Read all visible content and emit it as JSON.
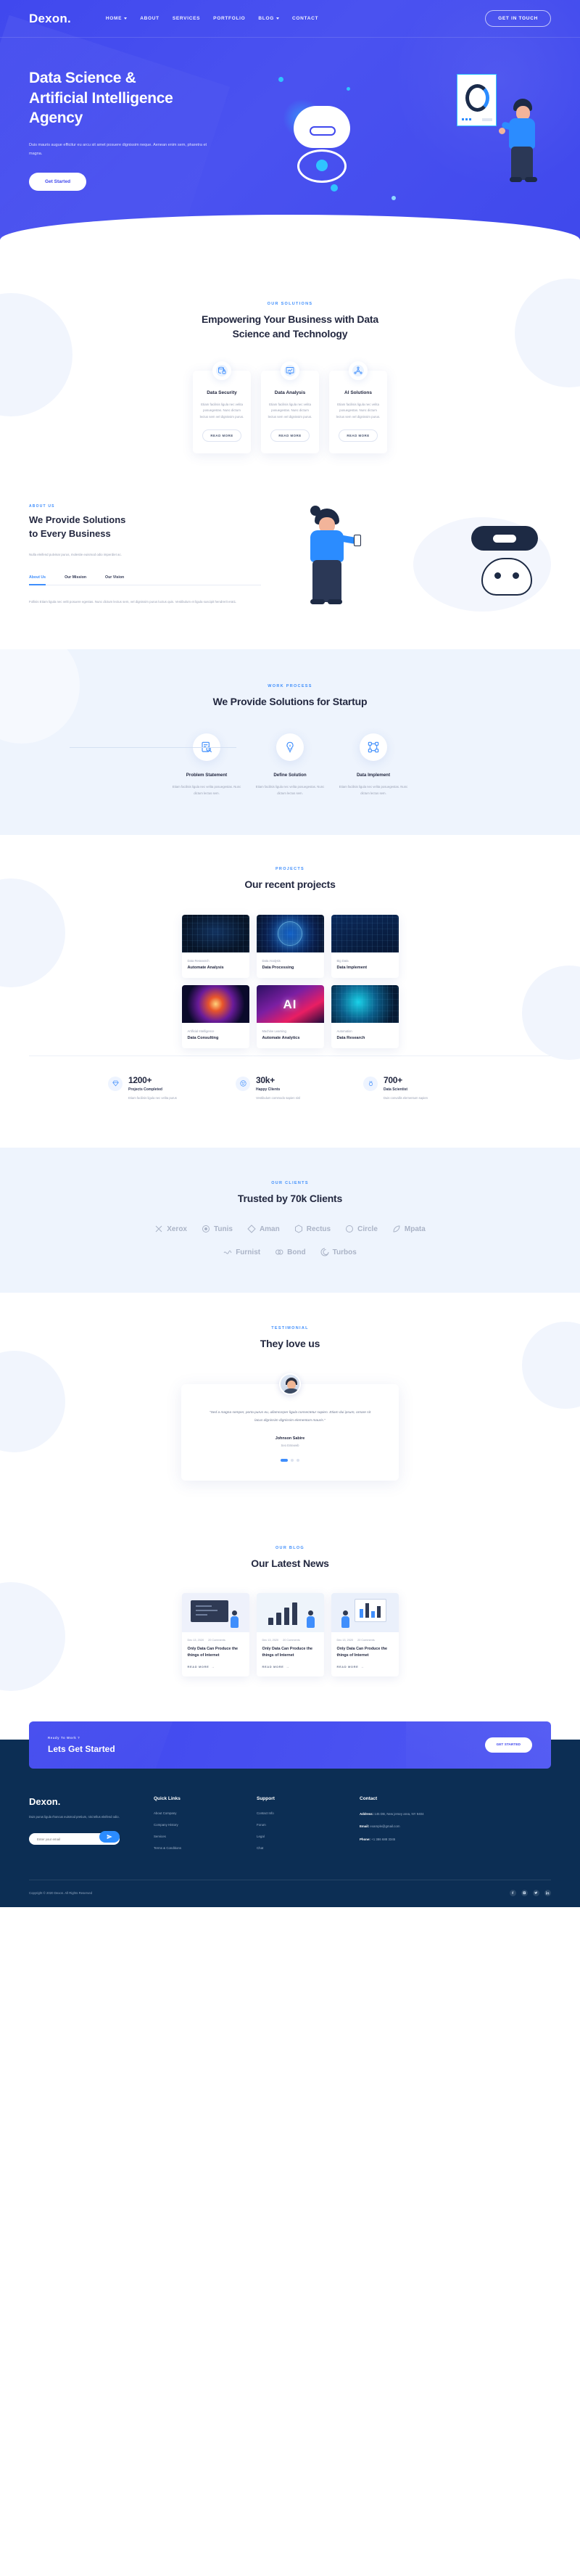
{
  "brand": {
    "name": "Dexon."
  },
  "nav": {
    "items": [
      {
        "label": "HOME",
        "has_dropdown": true
      },
      {
        "label": "ABOUT",
        "has_dropdown": false
      },
      {
        "label": "SERVICES",
        "has_dropdown": false
      },
      {
        "label": "PORTFOLIO",
        "has_dropdown": false
      },
      {
        "label": "BLOG",
        "has_dropdown": true
      },
      {
        "label": "CONTACT",
        "has_dropdown": false
      }
    ],
    "cta_label": "GET IN TOUCH"
  },
  "hero": {
    "title_line1": "Data Science &",
    "title_line2": "Artificial Intelligence",
    "title_line3": "Agency",
    "paragraph": "Duis mauris augue efficitur eu arcu sit amet posuere dignissim neque. Aenean enim sem, pharetra et magna.",
    "button_label": "Get Started"
  },
  "services": {
    "eyebrow": "OUR SOLUTIONS",
    "title_line1": "Empowering Your Business with Data",
    "title_line2": "Science and Technology",
    "read_more_label": "READ MORE",
    "cards": [
      {
        "icon": "database-lock-icon",
        "title": "Data Security",
        "text": "Etiam facilisis ligula nec velita posuegestas. Nunc dictum lectus sem vel dignissim purus."
      },
      {
        "icon": "data-analysis-icon",
        "title": "Data Analysis",
        "text": "Etiam facilisis ligula nec velita posuegestas. Nunc dictum lectus sem vel dignissim purus."
      },
      {
        "icon": "ai-network-icon",
        "title": "AI Solutions",
        "text": "Etiam facilisis ligula nec velita posuegestas. Nunc dictum lectus sem vel dignissim purus."
      }
    ]
  },
  "about": {
    "eyebrow": "ABOUT US",
    "title_line1": "We Provide Solutions",
    "title_line2": "to Every Business",
    "lead": "Nulla eleifend pulvinar purus, molestie euismod odio imperdiet ac.",
    "tabs": [
      {
        "label": "About Us",
        "active": true
      },
      {
        "label": "Our Mission",
        "active": false
      },
      {
        "label": "Our Vision",
        "active": false
      }
    ],
    "tab_body": "Follisis Etiam ligula nec velit posuere egestas. Nunc dictum lectus sem, vel dignissim purus luctus quis. Vestibulum et ligula suscipit hendrerit erat1."
  },
  "process": {
    "eyebrow": "WORK PROCESS",
    "title": "We Provide Solutions for Startup",
    "steps": [
      {
        "icon": "document-search-icon",
        "title": "Problem Statement",
        "text": "Etiam facilisis ligula nec velita posuegestas. Nunc dictum lectus sem."
      },
      {
        "icon": "bulb-gear-icon",
        "title": "Define Solution",
        "text": "Etiam facilisis ligula nec velita posuegestas. Nunc dictum lectus sem."
      },
      {
        "icon": "data-nodes-icon",
        "title": "Data Implement",
        "text": "Etiam facilisis ligula nec velita posuegestas. Nunc dictum lectus sem."
      }
    ]
  },
  "projects": {
    "eyebrow": "PROJECTS",
    "title": "Our recent projects",
    "items": [
      {
        "category": "Data Reseasrch",
        "title": "Automate Analysis",
        "thumb": "circuit-dark"
      },
      {
        "category": "Data Analysis",
        "title": "Data Processing",
        "thumb": "globe-blue"
      },
      {
        "category": "Big Data",
        "title": "Data Implement",
        "thumb": "data-streams"
      },
      {
        "category": "Artificial Intelligence",
        "title": "Data Consulting",
        "thumb": "cosmic-orb"
      },
      {
        "category": "Machine Learning",
        "title": "Automate Analytics",
        "thumb": "ai-letters"
      },
      {
        "category": "Automation",
        "title": "Data Research",
        "thumb": "neural-net"
      }
    ]
  },
  "stats": [
    {
      "icon": "diamond-icon",
      "number": "1200+",
      "label": "Projects Completed",
      "text": "Etiam facilisis ligula nec velita purus"
    },
    {
      "icon": "smile-icon",
      "number": "30k+",
      "label": "Happy Clients",
      "text": "Vestibulum commodo sapien nisl"
    },
    {
      "icon": "medal-icon",
      "number": "700+",
      "label": "Data Scientist",
      "text": "Duis convallis elementum sapien"
    }
  ],
  "clients": {
    "eyebrow": "OUR CLIENTS",
    "title": "Trusted by 70k Clients",
    "brands": [
      {
        "name": "Xerox",
        "icon": "x-mark-icon"
      },
      {
        "name": "Tunis",
        "icon": "circle-dot-icon"
      },
      {
        "name": "Aman",
        "icon": "diamond-outline-icon"
      },
      {
        "name": "Rectus",
        "icon": "hexagon-icon"
      },
      {
        "name": "Circle",
        "icon": "circle-outline-icon"
      },
      {
        "name": "Mpata",
        "icon": "leaf-icon"
      },
      {
        "name": "Furnist",
        "icon": "wave-icon"
      },
      {
        "name": "Bond",
        "icon": "ring-icon"
      },
      {
        "name": "Turbos",
        "icon": "spiral-icon"
      }
    ]
  },
  "testimonial": {
    "eyebrow": "TESTIMONIAL",
    "title": "They love us",
    "quote": "\"Sed a magna semper, porta purus eu, ullamcorper ligula consectetur sapien. Etiam dui ipsum, ornare sit lacus dignissim dignissim elementum mauris.\"",
    "name": "Johnson Sabire",
    "role": "Seo Enteweb"
  },
  "news": {
    "eyebrow": "OUR BLOG",
    "title": "Our Latest News",
    "read_more_label": "READ MORE",
    "posts": [
      {
        "date": "Dec 13, 2020",
        "comments": "20 Comments",
        "title_line1": "Only Data Can Produce the",
        "title_line2": "things of Internet",
        "image": "whiteboard-presentation"
      },
      {
        "date": "Dec 13, 2020",
        "comments": "20 Comments",
        "title_line1": "Only Data Can Produce the",
        "title_line2": "things of Internet",
        "image": "bar-chart-growth"
      },
      {
        "date": "Dec 13, 2020",
        "comments": "20 Comments",
        "title_line1": "Only Data Can Produce the",
        "title_line2": "things of Internet",
        "image": "analytics-board"
      }
    ]
  },
  "cta": {
    "small": "Ready To Work ?",
    "title": "Lets Get Started",
    "button_label": "GET STARTED"
  },
  "footer": {
    "logo": "Dexon.",
    "about": "Duis purus ligula rhoncus euismod pretium, nisi tellus eleifend odio.",
    "newsletter_placeholder": "Enter your email",
    "newsletter_icon": "send-icon",
    "quick_links": {
      "heading": "Quick Links",
      "items": [
        "About Company",
        "Company History",
        "Services",
        "Terms & Conditions"
      ]
    },
    "support": {
      "heading": "Support",
      "items": [
        "Contact Info",
        "Forum",
        "Legal",
        "Chat"
      ]
    },
    "contact": {
      "heading": "Contact",
      "address_label": "Address:",
      "address_value": "145 DB, New jersey area, NY 9404",
      "email_label": "Email:",
      "email_value": "example@gmail.com",
      "phone_label": "Phone:",
      "phone_value": "+1 386 688 3345"
    },
    "copyright": "Copyright © 2020 Dexon. All Rights Reserved",
    "socials": [
      "facebook-icon",
      "instagram-icon",
      "twitter-icon",
      "linkedin-icon"
    ]
  },
  "colors": {
    "primary": "#4048ee",
    "accent": "#3f8efc",
    "dark": "#232840",
    "footer_bg": "#0c2e54",
    "light_bg": "#eef4fd"
  }
}
